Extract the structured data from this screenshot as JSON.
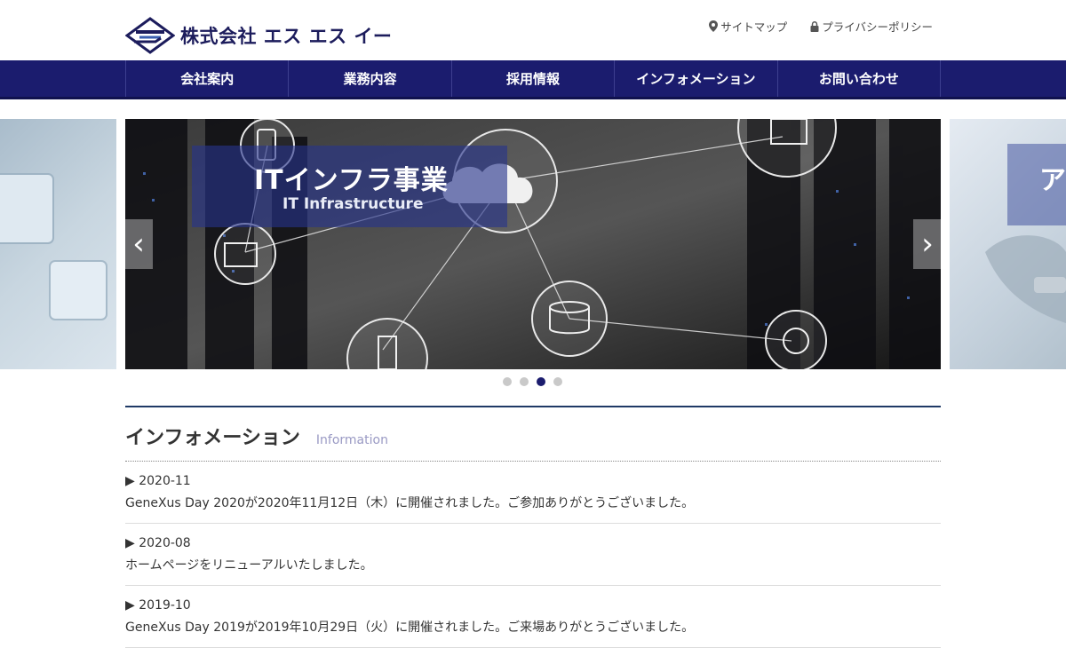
{
  "header": {
    "company_name": "株式会社 エス エス イー",
    "util_links": [
      {
        "label": "サイトマップ",
        "icon": "map-pin-icon"
      },
      {
        "label": "プライバシーポリシー",
        "icon": "lock-icon"
      }
    ]
  },
  "nav": {
    "items": [
      "会社案内",
      "業務内容",
      "採用情報",
      "インフォメーション",
      "お問い合わせ"
    ]
  },
  "slider": {
    "caption_title": "ITインフラ事業",
    "caption_sub": "IT Infrastructure",
    "right_caption": "ア",
    "prev_icon": "chevron-left-icon",
    "next_icon": "chevron-right-icon",
    "prev_glyph": "‹",
    "next_glyph": "›",
    "dots_count": 4,
    "active_dot": 3
  },
  "info": {
    "title": "インフォメーション",
    "subtitle": "Information",
    "items": [
      {
        "date": "▶ 2020-11",
        "text": "GeneXus Day 2020が2020年11月12日（木）に開催されました。ご参加ありがとうございました。"
      },
      {
        "date": "▶ 2020-08",
        "text": "ホームページをリニューアルいたしました。"
      },
      {
        "date": "▶ 2019-10",
        "text": "GeneXus Day 2019が2019年10月29日（火）に開催されました。ご来場ありがとうございました。"
      }
    ]
  },
  "colors": {
    "nav_bg": "#1b1c6e",
    "accent": "#1f3a66",
    "subtitle": "#9a9ac4"
  }
}
